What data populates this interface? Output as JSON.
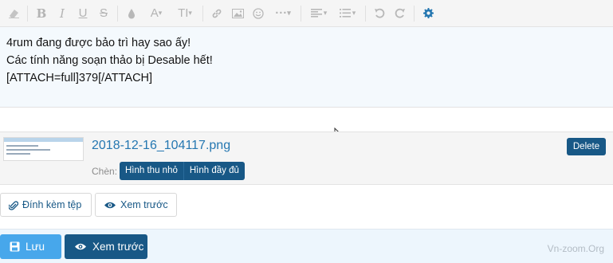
{
  "toolbar": {
    "buttons": [
      {
        "name": "clear-format-icon"
      },
      {
        "name": "bold-icon",
        "glyph": "B"
      },
      {
        "name": "italic-icon",
        "glyph": "I"
      },
      {
        "name": "underline-icon",
        "glyph": "U"
      },
      {
        "name": "strikethrough-icon",
        "glyph": "S"
      },
      {
        "name": "text-color-icon"
      },
      {
        "name": "font-family-icon",
        "glyph": "A▾"
      },
      {
        "name": "font-size-icon",
        "glyph": "TI▾"
      },
      {
        "name": "link-icon"
      },
      {
        "name": "image-icon"
      },
      {
        "name": "smilie-icon"
      },
      {
        "name": "more-options-icon",
        "glyph": "···▾"
      },
      {
        "name": "align-icon"
      },
      {
        "name": "list-icon"
      },
      {
        "name": "undo-icon"
      },
      {
        "name": "redo-icon"
      },
      {
        "name": "settings-gear-icon"
      }
    ],
    "accent_color": "#2577b1"
  },
  "editor": {
    "lines": [
      "4rum đang được bảo trì hay sao ấy!",
      "Các tính năng soạn thảo bị Desable hết!",
      "[ATTACH=full]379[/ATTACH]"
    ]
  },
  "attachment": {
    "filename": "2018-12-16_104117.png",
    "insert_label": "Chèn:",
    "insert_thumbnail_label": "Hình thu nhỏ",
    "insert_full_label": "Hình đầy đủ",
    "delete_label": "Delete"
  },
  "actions": {
    "attach_files_label": "Đính kèm tệp",
    "preview_label": "Xem trước"
  },
  "footer": {
    "save_label": "Lưu",
    "preview_label": "Xem trước",
    "watermark": "Vn-zoom.Org"
  },
  "colors": {
    "primary_dark": "#185886",
    "primary_light": "#47a7eb",
    "editor_bg": "#f4f9fd",
    "footer_bg": "#edf6fd"
  }
}
